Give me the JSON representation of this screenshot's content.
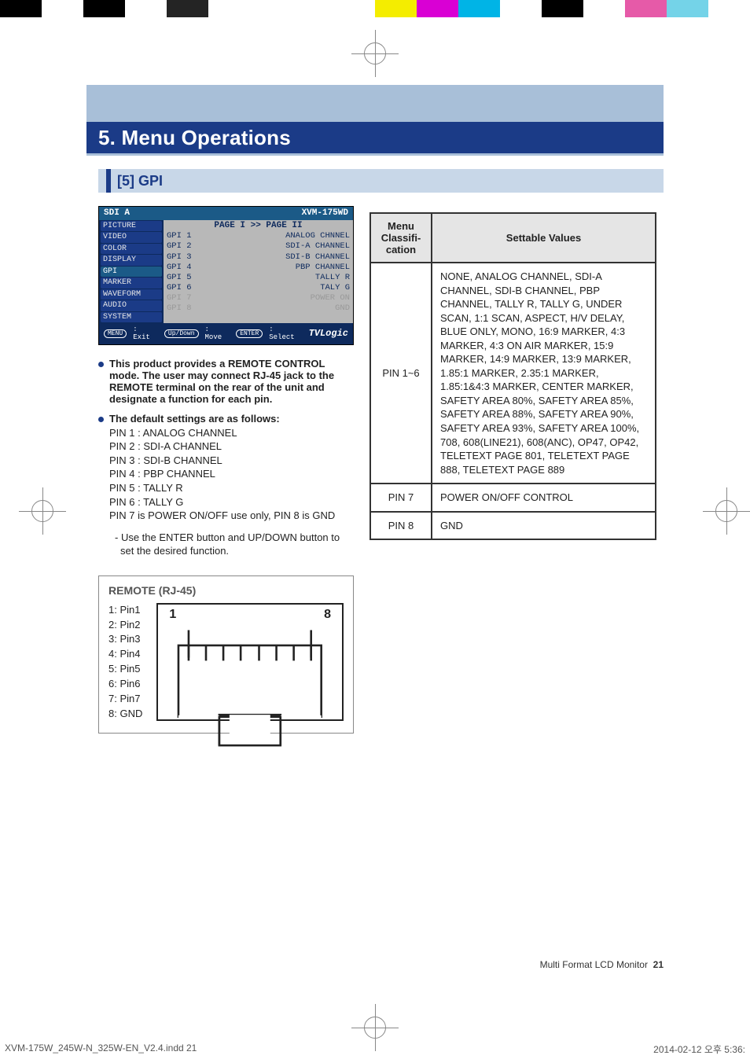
{
  "colorbar": [
    "#000",
    "#fff",
    "#000",
    "#fff",
    "#242424",
    "#fff",
    "#fff",
    "#fff",
    "#fff",
    "#f4ed00",
    "#d900d4",
    "#00b4e6",
    "#fff",
    "#000",
    "#fff",
    "#e65aa8",
    "#74d3e8",
    "#fff"
  ],
  "header": {
    "title": "5. Menu Operations"
  },
  "section": {
    "label": "[5] GPI"
  },
  "osd": {
    "title_left": "SDI A",
    "title_right": "XVM-175WD",
    "crumb": "PAGE I >> PAGE II",
    "side_items": [
      "PICTURE",
      "VIDEO",
      "COLOR",
      "DISPLAY",
      "GPI",
      "MARKER",
      "WAVEFORM",
      "AUDIO",
      "SYSTEM"
    ],
    "side_selected_index": 4,
    "rows": [
      {
        "k": "GPI 1",
        "v": "ANALOG CHNNEL",
        "dim": false
      },
      {
        "k": "GPI 2",
        "v": "SDI-A CHANNEL",
        "dim": false
      },
      {
        "k": "GPI 3",
        "v": "SDI-B CHANNEL",
        "dim": false
      },
      {
        "k": "GPI 4",
        "v": "PBP CHANNEL",
        "dim": false
      },
      {
        "k": "GPI 5",
        "v": "TALLY R",
        "dim": false
      },
      {
        "k": "GPI 6",
        "v": "TALY G",
        "dim": false
      },
      {
        "k": "GPI 7",
        "v": "POWER ON",
        "dim": true
      },
      {
        "k": "GPI 8",
        "v": "GND",
        "dim": true
      }
    ],
    "foot": {
      "menu": "MENU",
      "menu_lbl": ": Exit",
      "updown": "Up/Down",
      "updown_lbl": ": Move",
      "enter": "ENTER",
      "enter_lbl": ": Select",
      "brand": "TVLogic"
    }
  },
  "body": {
    "para1": "This product provides a REMOTE CONTROL mode. The user may connect RJ-45 jack to the REMOTE terminal on the rear of the unit and designate a function for each pin.",
    "para2_lead": "The default settings are as follows:",
    "defaults": [
      "PIN 1 : ANALOG CHANNEL",
      "PIN 2 : SDI-A CHANNEL",
      "PIN 3 : SDI-B CHANNEL",
      "PIN 4 : PBP CHANNEL",
      "PIN 5 : TALLY R",
      "PIN 6 : TALLY G",
      "PIN 7 is POWER ON/OFF use only, PIN 8 is GND"
    ],
    "note": "- Use the ENTER button and UP/DOWN button to set the desired function."
  },
  "rj45": {
    "title": "REMOTE (RJ-45)",
    "pins": [
      "1: Pin1",
      "2: Pin2",
      "3: Pin3",
      "4: Pin4",
      "5: Pin5",
      "6: Pin6",
      "7: Pin7",
      "8: GND"
    ],
    "label_left": "1",
    "label_right": "8"
  },
  "table": {
    "head1": "Menu Classifi-cation",
    "head2": "Settable Values",
    "rows": [
      {
        "k": "PIN 1~6",
        "v": "NONE, ANALOG CHANNEL, SDI-A CHANNEL, SDI-B CHANNEL, PBP CHANNEL, TALLY R, TALLY G, UNDER SCAN, 1:1 SCAN, ASPECT, H/V DELAY, BLUE ONLY, MONO, 16:9 MARKER, 4:3 MARKER, 4:3 ON AIR MARKER, 15:9 MARKER, 14:9 MARKER, 13:9 MARKER, 1.85:1 MARKER, 2.35:1 MARKER, 1.85:1&4:3 MARKER, CENTER MARKER, SAFETY AREA 80%, SAFETY AREA 85%, SAFETY AREA 88%, SAFETY AREA 90%, SAFETY AREA 93%, SAFETY AREA 100%, 708, 608(LINE21), 608(ANC), OP47, OP42, TELETEXT PAGE 801, TELETEXT PAGE 888, TELETEXT PAGE 889"
      },
      {
        "k": "PIN 7",
        "v": "POWER ON/OFF CONTROL"
      },
      {
        "k": "PIN 8",
        "v": "GND"
      }
    ]
  },
  "footer": {
    "text_prefix": "Multi Format LCD Monitor",
    "page": "21"
  },
  "slug": {
    "left": "XVM-175W_245W-N_325W-EN_V2.4.indd   21",
    "right": "2014-02-12   오후 5:36:"
  }
}
